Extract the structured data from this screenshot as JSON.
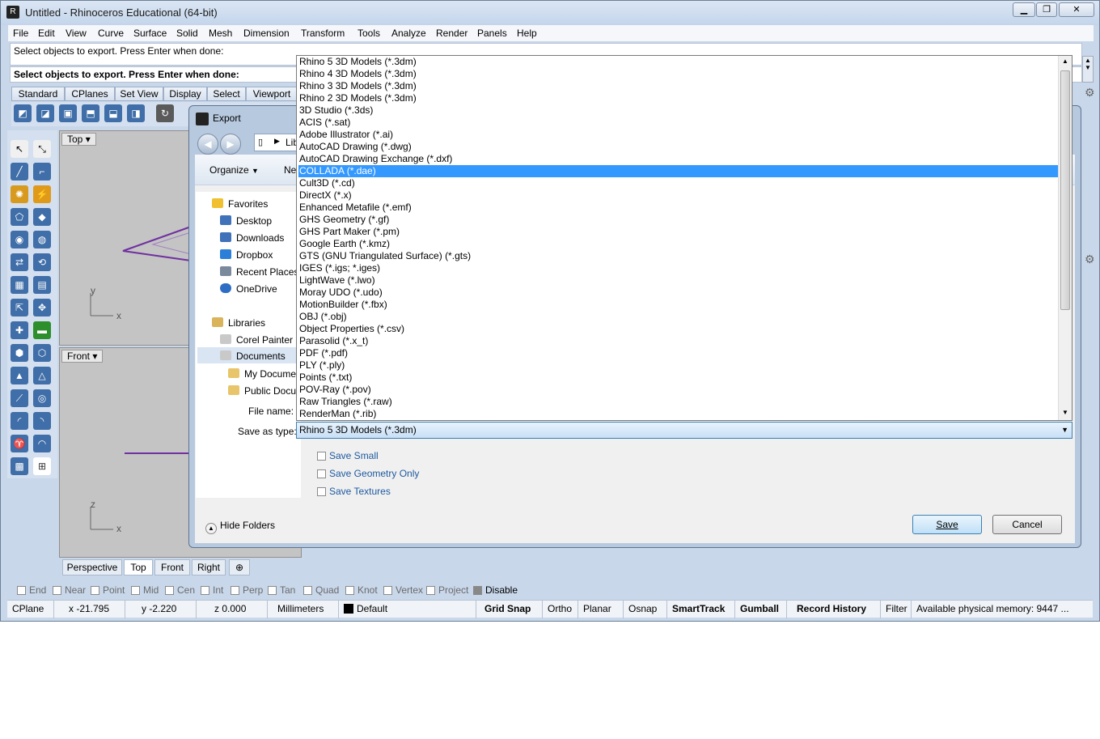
{
  "window": {
    "title": "Untitled - Rhinoceros Educational (64-bit)",
    "min": "▭",
    "max": "□",
    "close": "✕"
  },
  "menu": [
    "File",
    "Edit",
    "View",
    "Curve",
    "Surface",
    "Solid",
    "Mesh",
    "Dimension",
    "Transform",
    "Tools",
    "Analyze",
    "Render",
    "Panels",
    "Help"
  ],
  "command": {
    "history": "Select objects to export. Press Enter when done:",
    "prompt": "Select objects to export. Press Enter when done:"
  },
  "toolbar_tabs": [
    "Standard",
    "CPlanes",
    "Set View",
    "Display",
    "Select",
    "Viewport Lay"
  ],
  "viewports": {
    "top_label": "Top",
    "front_label": "Front",
    "axis_y": "y",
    "axis_x": "x",
    "axis_z": "z",
    "axis_x2": "x"
  },
  "bottom_tabs": [
    "Perspective",
    "Top",
    "Front",
    "Right"
  ],
  "osnap": [
    "End",
    "Near",
    "Point",
    "Mid",
    "Cen",
    "Int",
    "Perp",
    "Tan",
    "Quad",
    "Knot",
    "Vertex",
    "Project",
    "Disable"
  ],
  "status": {
    "cplane": "CPlane",
    "x": "x -21.795",
    "y": "y -2.220",
    "z": "z 0.000",
    "units": "Millimeters",
    "layer": "Default",
    "grid_snap": "Grid Snap",
    "ortho": "Ortho",
    "planar": "Planar",
    "osnap": "Osnap",
    "smarttrack": "SmartTrack",
    "gumball": "Gumball",
    "record_history": "Record History",
    "filter": "Filter",
    "memory": "Available physical memory: 9447 ..."
  },
  "dialog": {
    "title": "Export",
    "breadcrumb": "Lib",
    "organize": "Organize",
    "new_folder": "Ne",
    "nav": {
      "favorites": "Favorites",
      "fav_items": [
        "Desktop",
        "Downloads",
        "Dropbox",
        "Recent Places",
        "OneDrive"
      ],
      "libraries": "Libraries",
      "lib_items": [
        "Corel Painter",
        "Documents",
        "My Docume",
        "Public Docu"
      ]
    },
    "file_name_label": "File name:",
    "save_as_type_label": "Save as type:",
    "save_as_type_value": "Rhino 5 3D Models (*.3dm)",
    "file_types": [
      "Rhino 5 3D Models (*.3dm)",
      "Rhino 4 3D Models (*.3dm)",
      "Rhino 3 3D Models (*.3dm)",
      "Rhino 2 3D Models (*.3dm)",
      "3D Studio (*.3ds)",
      "ACIS (*.sat)",
      "Adobe Illustrator (*.ai)",
      "AutoCAD Drawing (*.dwg)",
      "AutoCAD Drawing Exchange (*.dxf)",
      "COLLADA (*.dae)",
      "Cult3D (*.cd)",
      "DirectX (*.x)",
      "Enhanced Metafile (*.emf)",
      "GHS Geometry (*.gf)",
      "GHS Part Maker (*.pm)",
      "Google Earth (*.kmz)",
      "GTS (GNU Triangulated Surface) (*.gts)",
      "IGES (*.igs; *.iges)",
      "LightWave (*.lwo)",
      "Moray UDO (*.udo)",
      "MotionBuilder (*.fbx)",
      "OBJ (*.obj)",
      "Object Properties (*.csv)",
      "Parasolid (*.x_t)",
      "PDF (*.pdf)",
      "PLY (*.ply)",
      "Points (*.txt)",
      "POV-Ray (*.pov)",
      "Raw Triangles (*.raw)",
      "RenderMan (*.rib)"
    ],
    "selected_type_index": 9,
    "options": [
      "Save Small",
      "Save Geometry Only",
      "Save Textures"
    ],
    "hide_folders": "Hide Folders",
    "save": "Save",
    "cancel": "Cancel"
  },
  "colors": {
    "accent": "#3399ff",
    "window": "#c8d7ea",
    "curve": "#7030a0"
  }
}
